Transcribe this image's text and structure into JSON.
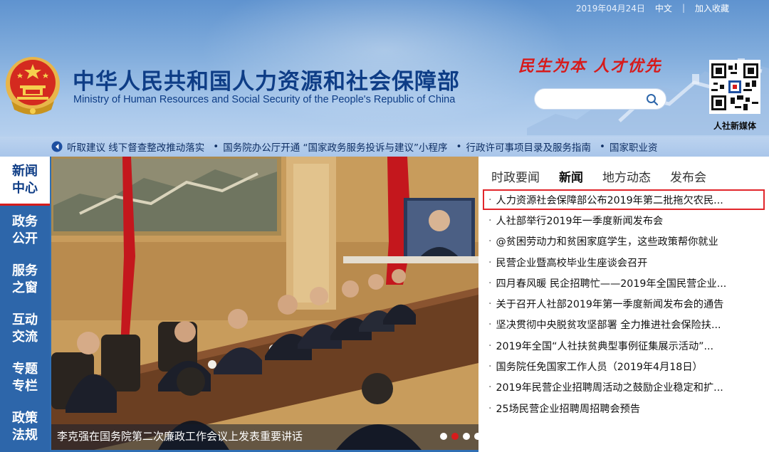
{
  "topbar": {
    "date": "2019年04月24日",
    "lang": "中文",
    "sep": "|",
    "bookmark": "加入收藏"
  },
  "header": {
    "title_zh": "中华人民共和国人力资源和社会保障部",
    "title_en": "Ministry of Human Resources and Social Security of the People's Republic of China",
    "slogan": "民生为本  人才优先",
    "search_placeholder": "",
    "qr_label": "人社新媒体"
  },
  "ticker": {
    "items": [
      "听取建议 线下督查整改推动落实",
      "国务院办公厅开通 “国家政务服务投诉与建议”小程序",
      "行政许可事项目录及服务指南",
      "国家职业资"
    ],
    "bullet": "•"
  },
  "leftnav": {
    "items": [
      {
        "label": "新闻中心"
      },
      {
        "label": "政务公开"
      },
      {
        "label": "服务之窗"
      },
      {
        "label": "互动交流"
      },
      {
        "label": "专题专栏"
      },
      {
        "label": "政策法规"
      }
    ]
  },
  "slide": {
    "caption": "李克强在国务院第二次廉政工作会议上发表重要讲话",
    "dots": 6,
    "active_dot": 2
  },
  "news": {
    "tabs": [
      "时政要闻",
      "新闻",
      "地方动态",
      "发布会"
    ],
    "active_tab": 1,
    "marker": "·",
    "items": [
      "人力资源社会保障部公布2019年第二批拖欠农民...",
      "人社部举行2019年一季度新闻发布会",
      "@贫困劳动力和贫困家庭学生，这些政策帮你就业",
      "民营企业暨高校毕业生座谈会召开",
      "四月春风暖 民企招聘忙——2019年全国民营企业...",
      "关于召开人社部2019年第一季度新闻发布会的通告",
      "坚决贯彻中央脱贫攻坚部署 全力推进社会保险扶...",
      "2019年全国“人社扶贫典型事例征集展示活动”...",
      "国务院任免国家工作人员（2019年4月18日）",
      "2019年民营企业招聘周活动之鼓励企业稳定和扩...",
      "25场民营企业招聘周招聘会预告"
    ]
  },
  "colors": {
    "brand_blue": "#0e3d86",
    "accent_red": "#d61c1c",
    "nav_blue": "#2d66aa"
  },
  "icons": [
    "national-emblem",
    "search-icon",
    "qr-code",
    "speaker-icon"
  ]
}
